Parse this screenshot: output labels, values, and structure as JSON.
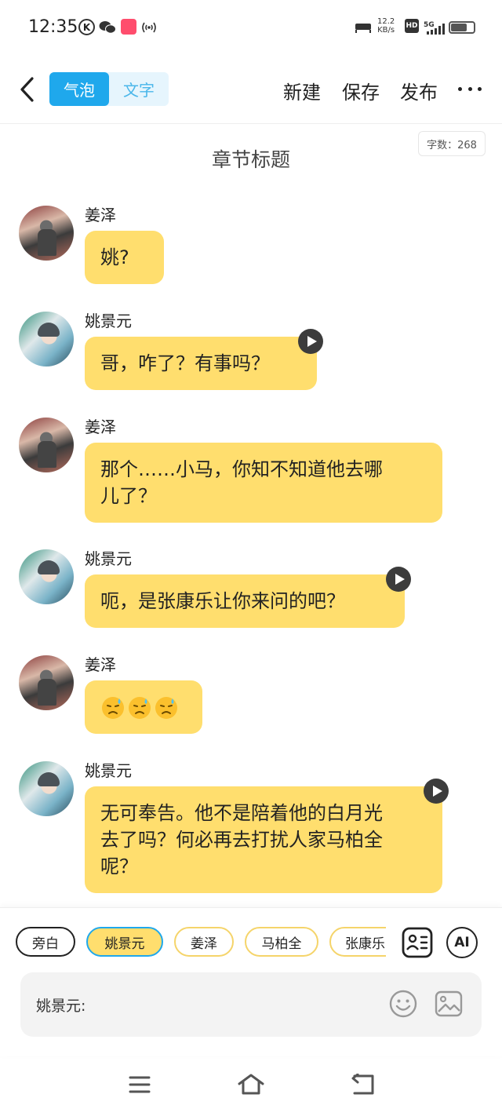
{
  "status_bar": {
    "time": "12:35",
    "k_badge": "K",
    "net_speed_value": "12.2",
    "net_speed_unit": "KB/s",
    "hd_label": "HD",
    "signal_label": "5G"
  },
  "header": {
    "tabs": [
      {
        "label": "气泡",
        "active": true
      },
      {
        "label": "文字",
        "active": false
      }
    ],
    "actions": {
      "new": "新建",
      "save": "保存",
      "publish": "发布"
    },
    "accent_color": "#1fa8ec"
  },
  "chapter": {
    "word_count": "字数：268",
    "title": "章节标题"
  },
  "messages": [
    {
      "speaker": "姜泽",
      "text": "姚?",
      "audio": false
    },
    {
      "speaker": "姚景元",
      "text": "哥，咋了？有事吗？",
      "audio": true
    },
    {
      "speaker": "姜泽",
      "line1": "那个……小马，你知不知道他去哪",
      "line2": "儿了？",
      "audio": false
    },
    {
      "speaker": "姚景元",
      "text": "呃，是张康乐让你来问的吧？",
      "audio": true
    },
    {
      "speaker": "姜泽",
      "emojis": [
        "downcast-sweat-emoji",
        "downcast-sweat-emoji",
        "downcast-sweat-emoji"
      ],
      "audio": false
    },
    {
      "speaker": "姚景元",
      "line1": "无可奉告。他不是陪着他的白月光",
      "line2": "去了吗？何必再去打扰人家马柏全",
      "line3": "呢？",
      "audio": true
    }
  ],
  "bubble_color": "#ffde6e",
  "character_chips": [
    {
      "label": "旁白",
      "active": false
    },
    {
      "label": "姚景元",
      "active": true
    },
    {
      "label": "姜泽",
      "active": false
    },
    {
      "label": "马柏全",
      "active": false
    },
    {
      "label": "张康乐",
      "active": false
    }
  ],
  "tools": {
    "ai_label": "AI",
    "cast_icon": "character-card-icon"
  },
  "input": {
    "speaker_prefix": "姚景元:"
  },
  "navbar": {
    "icons": [
      "menu-icon",
      "home-icon",
      "back-icon"
    ]
  }
}
